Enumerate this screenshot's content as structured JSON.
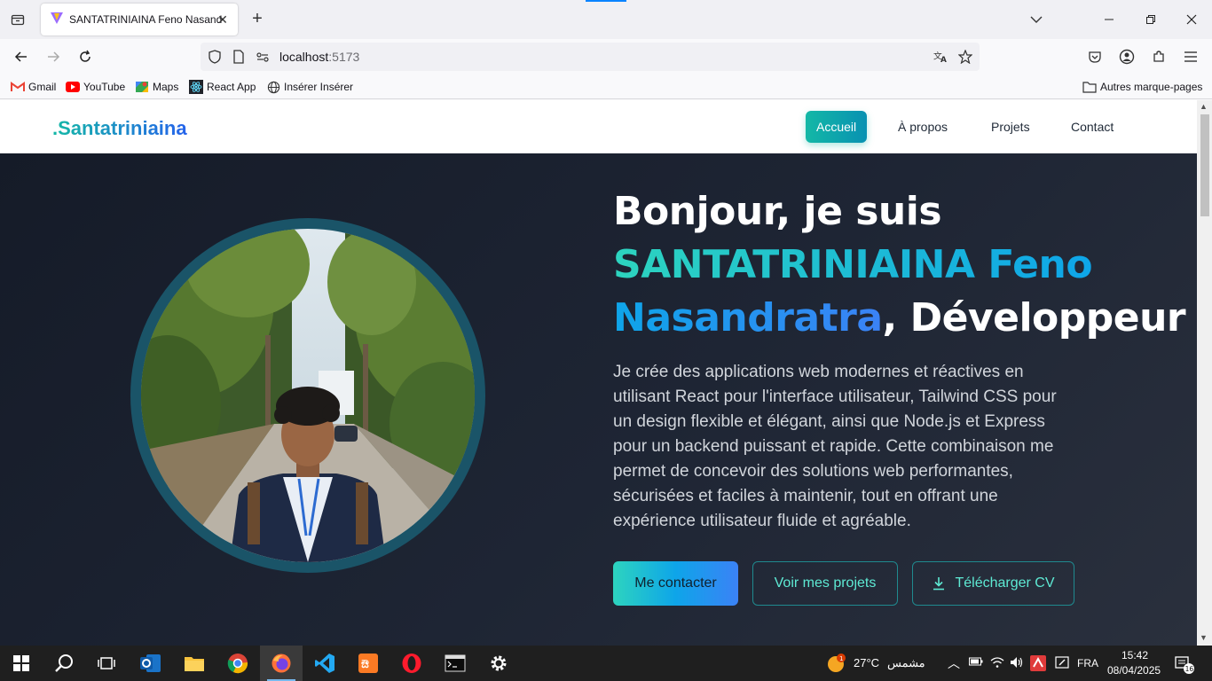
{
  "browser": {
    "tab_title": "SANTATRINIAINA Feno Nasandratra",
    "url_host": "localhost",
    "url_port": ":5173"
  },
  "bookmarks": [
    {
      "label": "Gmail",
      "icon": "gmail-icon"
    },
    {
      "label": "YouTube",
      "icon": "youtube-icon"
    },
    {
      "label": "Maps",
      "icon": "maps-icon"
    },
    {
      "label": "React App",
      "icon": "react-icon"
    },
    {
      "label": "Insérer Insérer",
      "icon": "globe-icon"
    }
  ],
  "bookmarks_other": "Autres marque-pages",
  "site": {
    "logo": ".Santatriniaina",
    "menu": [
      "Accueil",
      "À propos",
      "Projets",
      "Contact"
    ],
    "active_menu": "Accueil"
  },
  "hero": {
    "greeting": "Bonjour, je suis",
    "name_part1": "SANTATRINIAINA Feno",
    "name_part2": "Nasandratra",
    "role": ", Développeur",
    "description": "Je crée des applications web modernes et réactives en utilisant React pour l'interface utilisateur, Tailwind CSS pour un design flexible et élégant, ainsi que Node.js et Express pour un backend puissant et rapide. Cette combinaison me permet de concevoir des solutions web performantes, sécurisées et faciles à maintenir, tout en offrant une expérience utilisateur fluide et agréable.",
    "btn_contact": "Me contacter",
    "btn_projects": "Voir mes projets",
    "btn_cv": "Télécharger CV"
  },
  "taskbar": {
    "weather_temp": "27°C",
    "weather_label": "مشمس",
    "language": "FRA",
    "time": "15:42",
    "date": "08/04/2025",
    "notifications": "16",
    "weather_badge": "1"
  },
  "colors": {
    "accent_teal": "#14b8a6",
    "accent_blue": "#0ea5e9",
    "hero_bg": "#1b2230"
  }
}
